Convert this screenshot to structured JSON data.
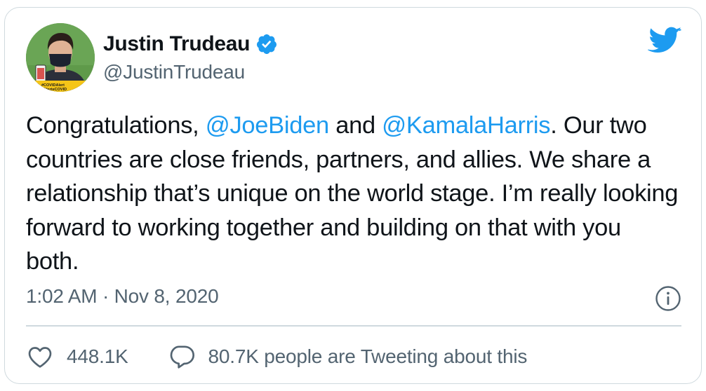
{
  "author": {
    "display_name": "Justin Trudeau",
    "handle": "@JustinTrudeau",
    "verified": true,
    "avatar_badge_line1": "#COVIDAlert",
    "avatar_badge_line2": "#AlerteCOVID"
  },
  "tweet": {
    "text_1": "Congratulations, ",
    "mention_1": "@JoeBiden",
    "text_2": " and ",
    "mention_2": "@KamalaHarris",
    "text_3": ". Our two countries are close friends, partners, and allies. We share a relationship that’s unique on the world stage. I’m really looking forward to working together and building on that with you both."
  },
  "meta": {
    "time": "1:02 AM",
    "separator": "·",
    "date": "Nov 8, 2020"
  },
  "actions": {
    "likes": "448.1K",
    "talking": "80.7K people are Tweeting about this"
  },
  "icons": {
    "logo": "twitter-bird-icon",
    "verified": "verified-badge-icon",
    "info": "info-icon",
    "like": "heart-icon",
    "reply": "speech-bubble-icon"
  },
  "colors": {
    "accent": "#1d9bf0",
    "text": "#0f1419",
    "secondary": "#536471",
    "border": "#cfd9de",
    "badge_yellow": "#f5c518"
  }
}
